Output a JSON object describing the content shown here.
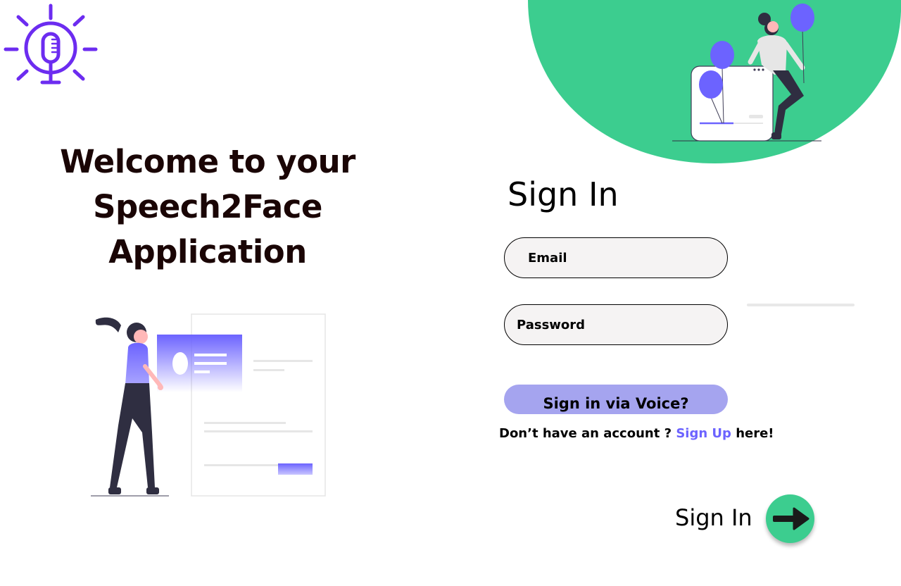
{
  "colors": {
    "accent": "#6c63ff",
    "logo": "#6c2cf0",
    "green": "#3ccd8f",
    "voice_button_bg": "#a5a4ef",
    "field_bg": "#f5f3f3",
    "heading": "#1a0505"
  },
  "icons": {
    "logo": "microphone-lightbulb-icon",
    "submit": "arrow-right-icon"
  },
  "welcome": {
    "line1": "Welcome to your",
    "line2": "Speech2Face",
    "line3": "Application"
  },
  "signin": {
    "title": "Sign In",
    "email_placeholder": "Email",
    "password_placeholder": "Password",
    "voice_button": "Sign in via Voice?",
    "no_account_text": "Don’t have an account ?",
    "signup_link": "Sign Up",
    "here_text": "here!",
    "submit_label": "Sign In"
  }
}
